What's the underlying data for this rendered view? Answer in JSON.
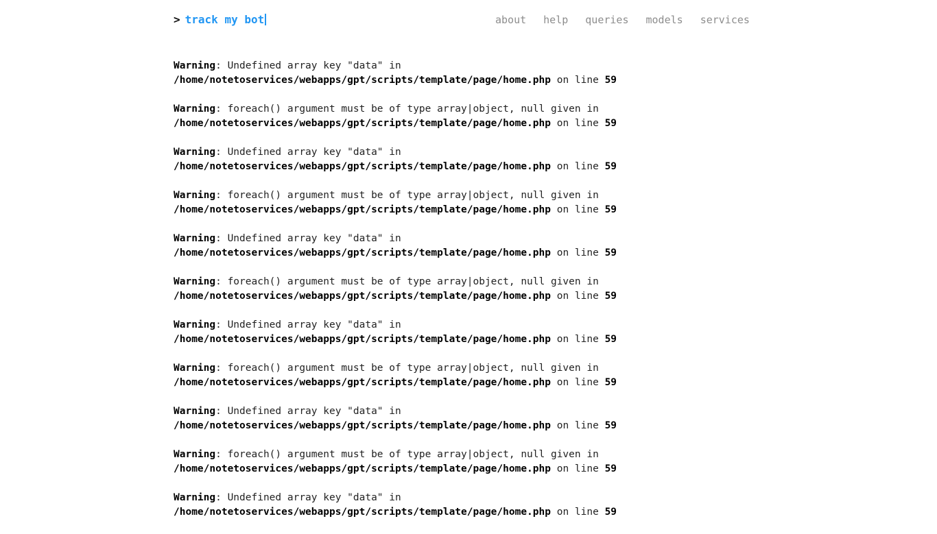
{
  "prompt": {
    "chevron": ">",
    "text": "track my bot",
    "cursor": "|"
  },
  "nav": {
    "items": [
      {
        "label": "about"
      },
      {
        "label": "help"
      },
      {
        "label": "queries"
      },
      {
        "label": "models"
      },
      {
        "label": "services"
      }
    ]
  },
  "warning_parts": {
    "label": "Warning",
    "msg_undefined": ": Undefined array key \"data\" in",
    "msg_foreach": ": foreach() argument must be of type array|object, null given in",
    "path": "/home/notetoservices/webapps/gpt/scripts/template/page/home.php",
    "on_line": " on line ",
    "line_number": "59"
  },
  "warnings": [
    {
      "type": "undefined",
      "message": ": Undefined array key \"data\" in",
      "path": "/home/notetoservices/webapps/gpt/scripts/template/page/home.php",
      "on_line": " on line ",
      "line": "59"
    },
    {
      "type": "foreach",
      "message": ": foreach() argument must be of type array|object, null given in",
      "path": "/home/notetoservices/webapps/gpt/scripts/template/page/home.php",
      "on_line": " on line ",
      "line": "59"
    },
    {
      "type": "undefined",
      "message": ": Undefined array key \"data\" in",
      "path": "/home/notetoservices/webapps/gpt/scripts/template/page/home.php",
      "on_line": " on line ",
      "line": "59"
    },
    {
      "type": "foreach",
      "message": ": foreach() argument must be of type array|object, null given in",
      "path": "/home/notetoservices/webapps/gpt/scripts/template/page/home.php",
      "on_line": " on line ",
      "line": "59"
    },
    {
      "type": "undefined",
      "message": ": Undefined array key \"data\" in",
      "path": "/home/notetoservices/webapps/gpt/scripts/template/page/home.php",
      "on_line": " on line ",
      "line": "59"
    },
    {
      "type": "foreach",
      "message": ": foreach() argument must be of type array|object, null given in",
      "path": "/home/notetoservices/webapps/gpt/scripts/template/page/home.php",
      "on_line": " on line ",
      "line": "59"
    },
    {
      "type": "undefined",
      "message": ": Undefined array key \"data\" in",
      "path": "/home/notetoservices/webapps/gpt/scripts/template/page/home.php",
      "on_line": " on line ",
      "line": "59"
    },
    {
      "type": "foreach",
      "message": ": foreach() argument must be of type array|object, null given in",
      "path": "/home/notetoservices/webapps/gpt/scripts/template/page/home.php",
      "on_line": " on line ",
      "line": "59"
    },
    {
      "type": "undefined",
      "message": ": Undefined array key \"data\" in",
      "path": "/home/notetoservices/webapps/gpt/scripts/template/page/home.php",
      "on_line": " on line ",
      "line": "59"
    },
    {
      "type": "foreach",
      "message": ": foreach() argument must be of type array|object, null given in",
      "path": "/home/notetoservices/webapps/gpt/scripts/template/page/home.php",
      "on_line": " on line ",
      "line": "59"
    },
    {
      "type": "undefined",
      "message": ": Undefined array key \"data\" in",
      "path": "/home/notetoservices/webapps/gpt/scripts/template/page/home.php",
      "on_line": " on line ",
      "line": "59"
    }
  ],
  "colors": {
    "background": "#ffffff",
    "prompt_blue": "#2196f3",
    "nav_gray": "#8d8d8d",
    "warning_text": "#222222",
    "warning_bold": "#000000"
  }
}
